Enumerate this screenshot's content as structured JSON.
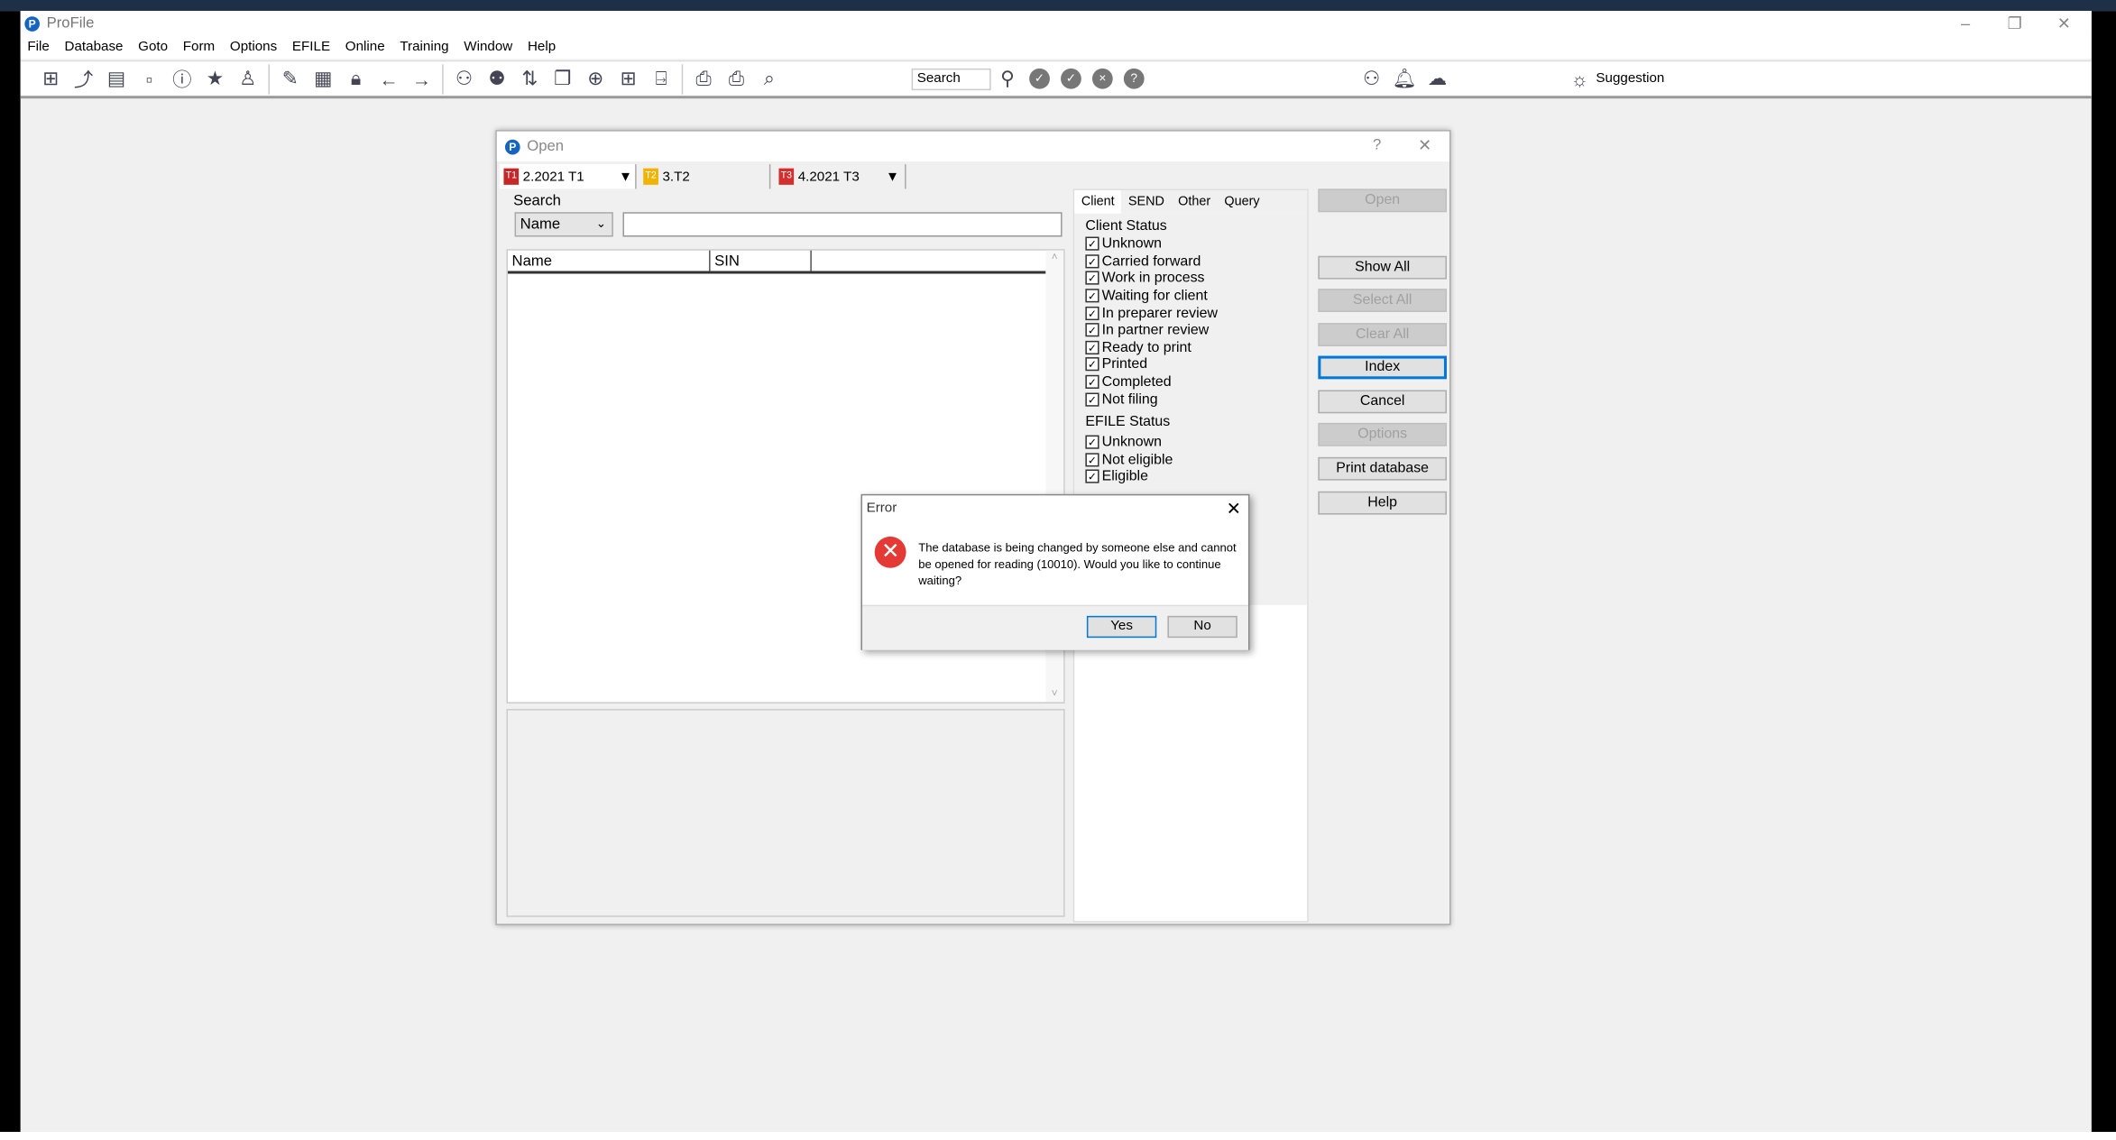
{
  "app": {
    "title": "ProFile"
  },
  "menu": [
    "File",
    "Database",
    "Goto",
    "Form",
    "Options",
    "EFILE",
    "Online",
    "Training",
    "Window",
    "Help"
  ],
  "toolbar": {
    "search_label": "Search",
    "suggestion_label": "Suggestion"
  },
  "open_dialog": {
    "title": "Open",
    "help": "?",
    "db_tabs": [
      {
        "icon": "T1",
        "label": "2.2021 T1"
      },
      {
        "icon": "T2",
        "label": "3.T2"
      },
      {
        "icon": "T3",
        "label": "4.2021 T3"
      }
    ],
    "search_label": "Search",
    "search_field": "Name",
    "search_value": "",
    "columns": [
      "Name",
      "SIN"
    ],
    "filter_tabs": [
      "Client",
      "SEND",
      "Other",
      "Query"
    ],
    "client_status_label": "Client Status",
    "client_status": [
      "Unknown",
      "Carried forward",
      "Work in process",
      "Waiting for client",
      "In preparer review",
      "In partner review",
      "Ready to print",
      "Printed",
      "Completed",
      "Not filing"
    ],
    "efile_status_label": "EFILE Status",
    "efile_status": [
      "Unknown",
      "Not eligible",
      "Eligible"
    ],
    "buttons": {
      "open": "Open",
      "show_all": "Show All",
      "select_all": "Select All",
      "clear_all": "Clear All",
      "index": "Index",
      "cancel": "Cancel",
      "options": "Options",
      "print_database": "Print database",
      "help": "Help"
    }
  },
  "error_dialog": {
    "title": "Error",
    "message": "The database is being changed by someone else and cannot be opened for reading (10010). Would you like to continue waiting?",
    "yes": "Yes",
    "no": "No"
  },
  "colors": {
    "accent": "#0078d7",
    "error": "#e53935",
    "taskbar": "#1e3048"
  }
}
